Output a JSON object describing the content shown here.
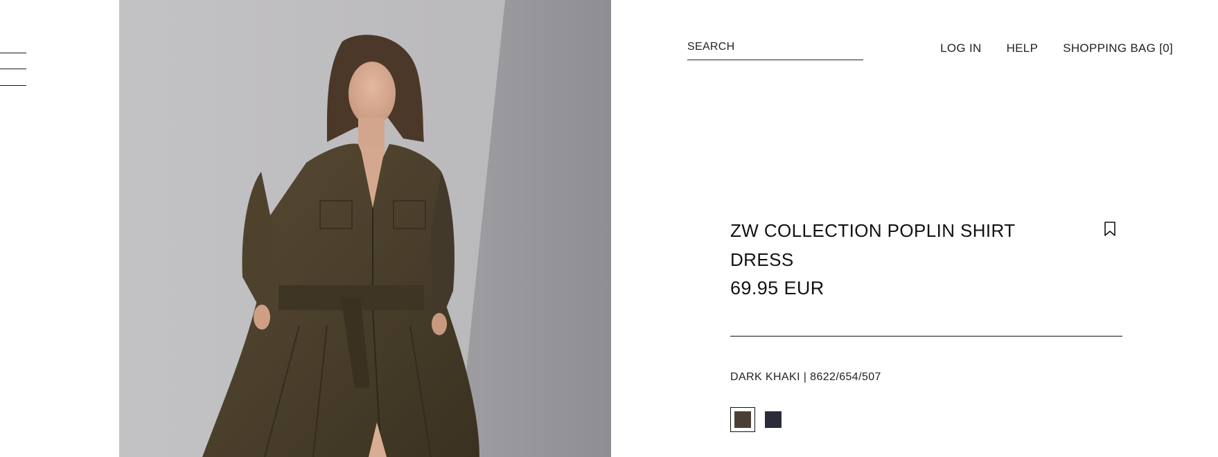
{
  "header": {
    "search_placeholder": "SEARCH",
    "nav": {
      "login": "LOG IN",
      "help": "HELP",
      "bag": "SHOPPING BAG [0]"
    }
  },
  "product": {
    "title": "ZW COLLECTION POPLIN SHIRT DRESS",
    "price": "69.95 EUR",
    "color_ref": "DARK KHAKI | 8622/654/507",
    "swatches": [
      {
        "name": "dark khaki",
        "color": "#4a3f34",
        "selected": true
      },
      {
        "name": "navy",
        "color": "#2b2b3a",
        "selected": false
      }
    ]
  },
  "icons": {
    "menu": "hamburger-menu-icon",
    "wishlist": "bookmark-icon"
  }
}
